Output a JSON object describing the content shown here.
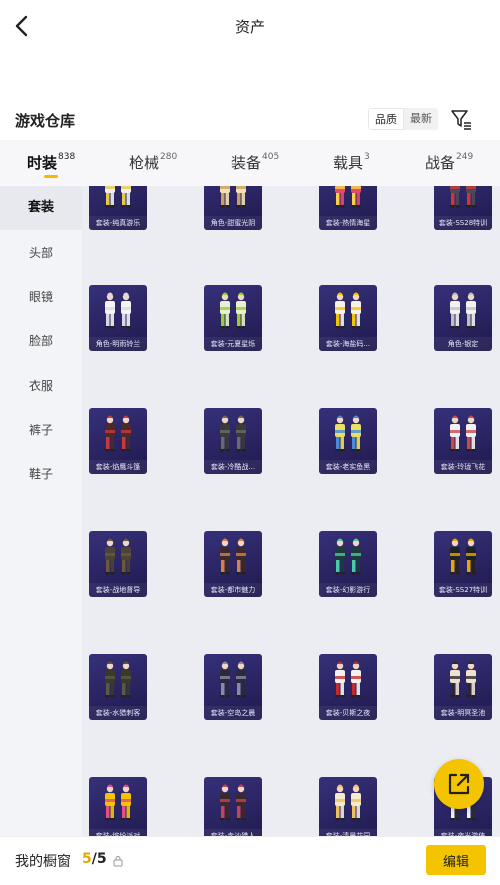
{
  "header": {
    "title": "资产"
  },
  "warehouse": {
    "title": "游戏仓库"
  },
  "sort": {
    "quality_label": "品质",
    "latest_label": "最新",
    "active": "quality"
  },
  "tabs": [
    {
      "label": "时装",
      "count": "838",
      "active": true
    },
    {
      "label": "枪械",
      "count": "280",
      "active": false
    },
    {
      "label": "装备",
      "count": "405",
      "active": false
    },
    {
      "label": "载具",
      "count": "3",
      "active": false
    },
    {
      "label": "战备",
      "count": "249",
      "active": false
    }
  ],
  "sidebar": {
    "items": [
      {
        "label": "套装",
        "active": true
      },
      {
        "label": "头部",
        "active": false
      },
      {
        "label": "眼镜",
        "active": false
      },
      {
        "label": "脸部",
        "active": false
      },
      {
        "label": "衣服",
        "active": false
      },
      {
        "label": "裤子",
        "active": false
      },
      {
        "label": "鞋子",
        "active": false
      }
    ]
  },
  "items": [
    {
      "name": "套装-纯真游乐",
      "palette": [
        "#f0f0f0",
        "#e6c84a"
      ]
    },
    {
      "name": "角色-甜蜜光阴",
      "palette": [
        "#f2e2b8",
        "#c8a060"
      ]
    },
    {
      "name": "套装-热情海星",
      "palette": [
        "#e84a6a",
        "#f5d24a"
      ]
    },
    {
      "name": "套装-SS28特训",
      "palette": [
        "#4a4a5a",
        "#c83a3a"
      ]
    },
    {
      "name": "角色-明雨铃兰",
      "palette": [
        "#f4f4f4",
        "#d8d8e6"
      ]
    },
    {
      "name": "套装-元夏星烁",
      "palette": [
        "#e8f0d0",
        "#9acd32"
      ]
    },
    {
      "name": "套装-海盐码...",
      "palette": [
        "#f6f2e6",
        "#f5c400"
      ]
    },
    {
      "name": "角色-银定",
      "palette": [
        "#f2f2f2",
        "#c0c0c0"
      ]
    },
    {
      "name": "套装-焰鹰斗篷",
      "palette": [
        "#4a2a2a",
        "#c83a3a"
      ]
    },
    {
      "name": "套装-冷酷战...",
      "palette": [
        "#3a3a3a",
        "#6a6a6a"
      ]
    },
    {
      "name": "套装-老实鱼黑",
      "palette": [
        "#e6e066",
        "#4a8ad8"
      ]
    },
    {
      "name": "套装-玲珑飞花",
      "palette": [
        "#f2f2f2",
        "#c84a4a"
      ]
    },
    {
      "name": "套装-战地督导",
      "palette": [
        "#4a4434",
        "#6a5a3a"
      ]
    },
    {
      "name": "套装-都市魅力",
      "palette": [
        "#3a2a2a",
        "#d8804a"
      ]
    },
    {
      "name": "套装-幻影游行",
      "palette": [
        "#1e3a3a",
        "#4ac8a8"
      ]
    },
    {
      "name": "套装-SS27特训",
      "palette": [
        "#222222",
        "#e6a800"
      ]
    },
    {
      "name": "套装-水猎刺客",
      "palette": [
        "#3a3a2a",
        "#5a5a44"
      ]
    },
    {
      "name": "套装-空岛之晨",
      "palette": [
        "#2a2a3a",
        "#8a8aa8"
      ]
    },
    {
      "name": "套装-贝斯之夜",
      "palette": [
        "#f2f2f2",
        "#c82a2a"
      ]
    },
    {
      "name": "套装-明冥圣池",
      "palette": [
        "#f0e0d0",
        "#2a2a2a"
      ]
    },
    {
      "name": "套装-缤纷派对",
      "palette": [
        "#f5c400",
        "#e84a8a"
      ]
    },
    {
      "name": "套装-赤沙猎人",
      "palette": [
        "#3a2a2a",
        "#c8405a"
      ]
    },
    {
      "name": "套装-清晨花园",
      "palette": [
        "#f4ead0",
        "#f0c060"
      ]
    },
    {
      "name": "套装-夜光游侠",
      "palette": [
        "#2a2a3a",
        "#f2f2f2"
      ]
    }
  ],
  "bottom": {
    "label": "我的橱窗",
    "current": "5",
    "separator": "/",
    "max": "5",
    "edit_label": "编辑"
  },
  "colors": {
    "accent": "#f5c400",
    "card_bg": "#2a2462"
  }
}
